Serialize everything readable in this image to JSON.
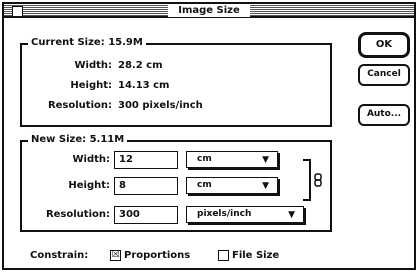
{
  "window": {
    "title": "Image Size"
  },
  "current_size": {
    "label": "Current Size: 15.9M",
    "rows": [
      {
        "label": "Width:",
        "value": "28.2 cm"
      },
      {
        "label": "Height:",
        "value": "14.13 cm"
      },
      {
        "label": "Resolution:",
        "value": "300 pixels/inch"
      }
    ]
  },
  "new_size": {
    "label": "New Size: 5.11M",
    "width": {
      "label": "Width:",
      "value": "12",
      "unit": "cm"
    },
    "height": {
      "label": "Height:",
      "value": "8",
      "unit": "cm"
    },
    "resolution": {
      "label": "Resolution:",
      "value": "300",
      "unit": "pixels/inch"
    }
  },
  "buttons": {
    "ok": "OK",
    "cancel": "Cancel",
    "auto": "Auto..."
  },
  "constrain": {
    "label": "Constrain:",
    "proportions": {
      "label": "Proportions",
      "checked": true,
      "mark": "☒"
    },
    "file_size": {
      "label": "File Size",
      "checked": false,
      "mark": ""
    }
  },
  "icons": {
    "link": "link-chain-icon",
    "caret": "▼"
  }
}
